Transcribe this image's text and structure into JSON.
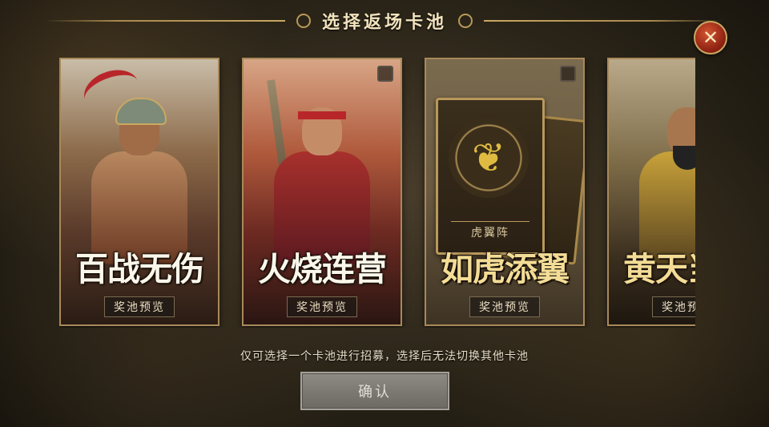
{
  "header": {
    "title": "选择返场卡池"
  },
  "close_button": {
    "icon": "close-icon",
    "glyph": "✕"
  },
  "cards": [
    {
      "title": "百战无伤",
      "preview_label": "奖池预览",
      "selected": false,
      "show_checkbox": false
    },
    {
      "title": "火烧连营",
      "preview_label": "奖池预览",
      "selected": false,
      "show_checkbox": true
    },
    {
      "title": "如虎添翼",
      "preview_label": "奖池预览",
      "selected": false,
      "show_checkbox": true,
      "inner_card_label": "虎翼阵",
      "emblem_icon": "tiger-icon"
    },
    {
      "title": "黄天当立",
      "preview_label": "奖池预览",
      "selected": false,
      "show_checkbox": false
    }
  ],
  "hint": "仅可选择一个卡池进行招募，选择后无法切换其他卡池",
  "confirm_button": {
    "label": "确认",
    "enabled": false
  },
  "colors": {
    "gold": "#c9a862",
    "title_text": "#f2e3bd",
    "close_red": "#b8262a",
    "disabled_button": "#7c7872"
  }
}
